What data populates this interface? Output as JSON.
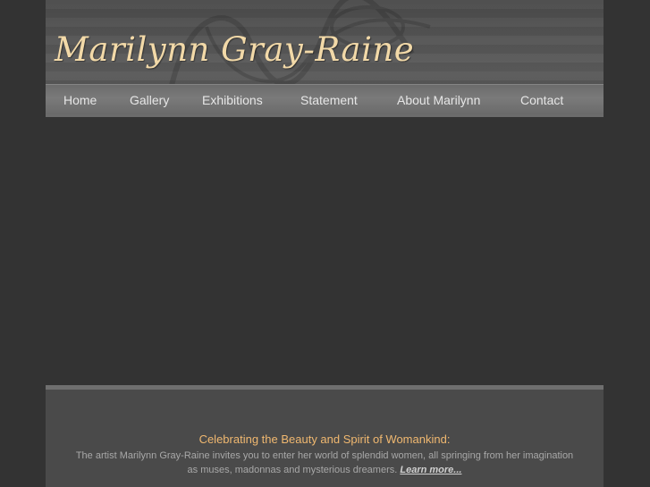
{
  "site": {
    "title": "Marilynn Gray-Raine"
  },
  "nav": {
    "items": [
      {
        "label": "Home"
      },
      {
        "label": "Gallery"
      },
      {
        "label": "Exhibitions"
      },
      {
        "label": "Statement"
      },
      {
        "label": "About Marilynn"
      },
      {
        "label": "Contact"
      }
    ]
  },
  "footer": {
    "heading": "Celebrating the Beauty and Spirit of Womankind:",
    "line1": "The artist Marilynn Gray-Raine invites you to enter her world of splendid women, all springing from her imagination",
    "line2": "as muses, madonnas and mysterious dreamers.",
    "learn_more": "Learn more..."
  },
  "colors": {
    "background": "#333333",
    "title_gold": "#f2d9a8",
    "heading_orange": "#f0b870"
  }
}
